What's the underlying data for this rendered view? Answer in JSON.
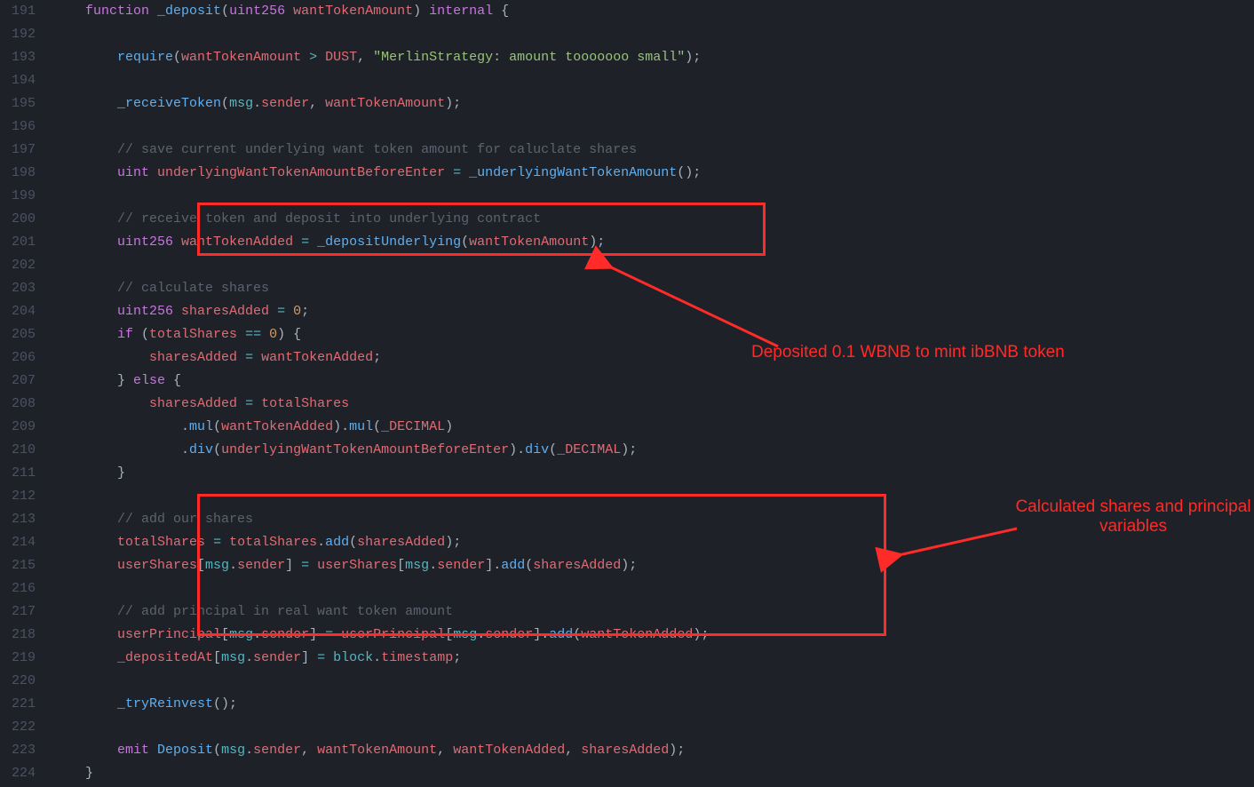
{
  "lineStart": 191,
  "lineEnd": 224,
  "annotations": {
    "anno1": "Deposited 0.1 WBNB to mint ibBNB token",
    "anno2": "Calculated shares and principal variables"
  },
  "code": [
    [
      [
        "pad",
        "    "
      ],
      [
        "keyword",
        "function"
      ],
      [
        "punct",
        " "
      ],
      [
        "func",
        "_deposit"
      ],
      [
        "punct",
        "("
      ],
      [
        "type",
        "uint256"
      ],
      [
        "punct",
        " "
      ],
      [
        "var",
        "wantTokenAmount"
      ],
      [
        "punct",
        ") "
      ],
      [
        "keyword",
        "internal"
      ],
      [
        "punct",
        " {"
      ]
    ],
    [],
    [
      [
        "pad",
        "        "
      ],
      [
        "func",
        "require"
      ],
      [
        "punct",
        "("
      ],
      [
        "var",
        "wantTokenAmount"
      ],
      [
        "punct",
        " "
      ],
      [
        "operator",
        ">"
      ],
      [
        "punct",
        " "
      ],
      [
        "var",
        "DUST"
      ],
      [
        "punct",
        ", "
      ],
      [
        "string",
        "\"MerlinStrategy: amount tooooooo small\""
      ],
      [
        "punct",
        ");"
      ]
    ],
    [],
    [
      [
        "pad",
        "        "
      ],
      [
        "func",
        "_receiveToken"
      ],
      [
        "punct",
        "("
      ],
      [
        "builtin",
        "msg"
      ],
      [
        "punct",
        "."
      ],
      [
        "property",
        "sender"
      ],
      [
        "punct",
        ", "
      ],
      [
        "var",
        "wantTokenAmount"
      ],
      [
        "punct",
        ");"
      ]
    ],
    [],
    [
      [
        "pad",
        "        "
      ],
      [
        "comment",
        "// save current underlying want token amount for caluclate shares"
      ]
    ],
    [
      [
        "pad",
        "        "
      ],
      [
        "type",
        "uint"
      ],
      [
        "punct",
        " "
      ],
      [
        "var",
        "underlyingWantTokenAmountBeforeEnter"
      ],
      [
        "punct",
        " "
      ],
      [
        "operator",
        "="
      ],
      [
        "punct",
        " "
      ],
      [
        "func",
        "_underlyingWantTokenAmount"
      ],
      [
        "punct",
        "();"
      ]
    ],
    [],
    [
      [
        "pad",
        "        "
      ],
      [
        "comment",
        "// receive token and deposit into underlying contract"
      ]
    ],
    [
      [
        "pad",
        "        "
      ],
      [
        "type",
        "uint256"
      ],
      [
        "punct",
        " "
      ],
      [
        "var",
        "wantTokenAdded"
      ],
      [
        "punct",
        " "
      ],
      [
        "operator",
        "="
      ],
      [
        "punct",
        " "
      ],
      [
        "func",
        "_depositUnderlying"
      ],
      [
        "punct",
        "("
      ],
      [
        "var",
        "wantTokenAmount"
      ],
      [
        "punct",
        ");"
      ]
    ],
    [],
    [
      [
        "pad",
        "        "
      ],
      [
        "comment",
        "// calculate shares"
      ]
    ],
    [
      [
        "pad",
        "        "
      ],
      [
        "type",
        "uint256"
      ],
      [
        "punct",
        " "
      ],
      [
        "var",
        "sharesAdded"
      ],
      [
        "punct",
        " "
      ],
      [
        "operator",
        "="
      ],
      [
        "punct",
        " "
      ],
      [
        "number",
        "0"
      ],
      [
        "punct",
        ";"
      ]
    ],
    [
      [
        "pad",
        "        "
      ],
      [
        "keyword",
        "if"
      ],
      [
        "punct",
        " ("
      ],
      [
        "var",
        "totalShares"
      ],
      [
        "punct",
        " "
      ],
      [
        "operator",
        "=="
      ],
      [
        "punct",
        " "
      ],
      [
        "number",
        "0"
      ],
      [
        "punct",
        ") {"
      ]
    ],
    [
      [
        "pad",
        "            "
      ],
      [
        "var",
        "sharesAdded"
      ],
      [
        "punct",
        " "
      ],
      [
        "operator",
        "="
      ],
      [
        "punct",
        " "
      ],
      [
        "var",
        "wantTokenAdded"
      ],
      [
        "punct",
        ";"
      ]
    ],
    [
      [
        "pad",
        "        "
      ],
      [
        "punct",
        "} "
      ],
      [
        "keyword",
        "else"
      ],
      [
        "punct",
        " {"
      ]
    ],
    [
      [
        "pad",
        "            "
      ],
      [
        "var",
        "sharesAdded"
      ],
      [
        "punct",
        " "
      ],
      [
        "operator",
        "="
      ],
      [
        "punct",
        " "
      ],
      [
        "var",
        "totalShares"
      ]
    ],
    [
      [
        "pad",
        "                "
      ],
      [
        "punct",
        "."
      ],
      [
        "method",
        "mul"
      ],
      [
        "punct",
        "("
      ],
      [
        "var",
        "wantTokenAdded"
      ],
      [
        "punct",
        ")."
      ],
      [
        "method",
        "mul"
      ],
      [
        "punct",
        "("
      ],
      [
        "var",
        "_DECIMAL"
      ],
      [
        "punct",
        ")"
      ]
    ],
    [
      [
        "pad",
        "                "
      ],
      [
        "punct",
        "."
      ],
      [
        "method",
        "div"
      ],
      [
        "punct",
        "("
      ],
      [
        "var",
        "underlyingWantTokenAmountBeforeEnter"
      ],
      [
        "punct",
        ")."
      ],
      [
        "method",
        "div"
      ],
      [
        "punct",
        "("
      ],
      [
        "var",
        "_DECIMAL"
      ],
      [
        "punct",
        ");"
      ]
    ],
    [
      [
        "pad",
        "        "
      ],
      [
        "punct",
        "}"
      ]
    ],
    [],
    [
      [
        "pad",
        "        "
      ],
      [
        "comment",
        "// add our shares"
      ]
    ],
    [
      [
        "pad",
        "        "
      ],
      [
        "var",
        "totalShares"
      ],
      [
        "punct",
        " "
      ],
      [
        "operator",
        "="
      ],
      [
        "punct",
        " "
      ],
      [
        "var",
        "totalShares"
      ],
      [
        "punct",
        "."
      ],
      [
        "method",
        "add"
      ],
      [
        "punct",
        "("
      ],
      [
        "var",
        "sharesAdded"
      ],
      [
        "punct",
        ");"
      ]
    ],
    [
      [
        "pad",
        "        "
      ],
      [
        "var",
        "userShares"
      ],
      [
        "punct",
        "["
      ],
      [
        "builtin",
        "msg"
      ],
      [
        "punct",
        "."
      ],
      [
        "property",
        "sender"
      ],
      [
        "punct",
        "] "
      ],
      [
        "operator",
        "="
      ],
      [
        "punct",
        " "
      ],
      [
        "var",
        "userShares"
      ],
      [
        "punct",
        "["
      ],
      [
        "builtin",
        "msg"
      ],
      [
        "punct",
        "."
      ],
      [
        "property",
        "sender"
      ],
      [
        "punct",
        "]."
      ],
      [
        "method",
        "add"
      ],
      [
        "punct",
        "("
      ],
      [
        "var",
        "sharesAdded"
      ],
      [
        "punct",
        ");"
      ]
    ],
    [],
    [
      [
        "pad",
        "        "
      ],
      [
        "comment",
        "// add principal in real want token amount"
      ]
    ],
    [
      [
        "pad",
        "        "
      ],
      [
        "var",
        "userPrincipal"
      ],
      [
        "punct",
        "["
      ],
      [
        "builtin",
        "msg"
      ],
      [
        "punct",
        "."
      ],
      [
        "property",
        "sender"
      ],
      [
        "punct",
        "] "
      ],
      [
        "operator",
        "="
      ],
      [
        "punct",
        " "
      ],
      [
        "var",
        "userPrincipal"
      ],
      [
        "punct",
        "["
      ],
      [
        "builtin",
        "msg"
      ],
      [
        "punct",
        "."
      ],
      [
        "property",
        "sender"
      ],
      [
        "punct",
        "]."
      ],
      [
        "method",
        "add"
      ],
      [
        "punct",
        "("
      ],
      [
        "var",
        "wantTokenAdded"
      ],
      [
        "punct",
        ");"
      ]
    ],
    [
      [
        "pad",
        "        "
      ],
      [
        "var",
        "_depositedAt"
      ],
      [
        "punct",
        "["
      ],
      [
        "builtin",
        "msg"
      ],
      [
        "punct",
        "."
      ],
      [
        "property",
        "sender"
      ],
      [
        "punct",
        "] "
      ],
      [
        "operator",
        "="
      ],
      [
        "punct",
        " "
      ],
      [
        "builtin",
        "block"
      ],
      [
        "punct",
        "."
      ],
      [
        "property",
        "timestamp"
      ],
      [
        "punct",
        ";"
      ]
    ],
    [],
    [
      [
        "pad",
        "        "
      ],
      [
        "func",
        "_tryReinvest"
      ],
      [
        "punct",
        "();"
      ]
    ],
    [],
    [
      [
        "pad",
        "        "
      ],
      [
        "keyword",
        "emit"
      ],
      [
        "punct",
        " "
      ],
      [
        "func",
        "Deposit"
      ],
      [
        "punct",
        "("
      ],
      [
        "builtin",
        "msg"
      ],
      [
        "punct",
        "."
      ],
      [
        "property",
        "sender"
      ],
      [
        "punct",
        ", "
      ],
      [
        "var",
        "wantTokenAmount"
      ],
      [
        "punct",
        ", "
      ],
      [
        "var",
        "wantTokenAdded"
      ],
      [
        "punct",
        ", "
      ],
      [
        "var",
        "sharesAdded"
      ],
      [
        "punct",
        ");"
      ]
    ],
    [
      [
        "pad",
        "    "
      ],
      [
        "punct",
        "}"
      ]
    ]
  ]
}
